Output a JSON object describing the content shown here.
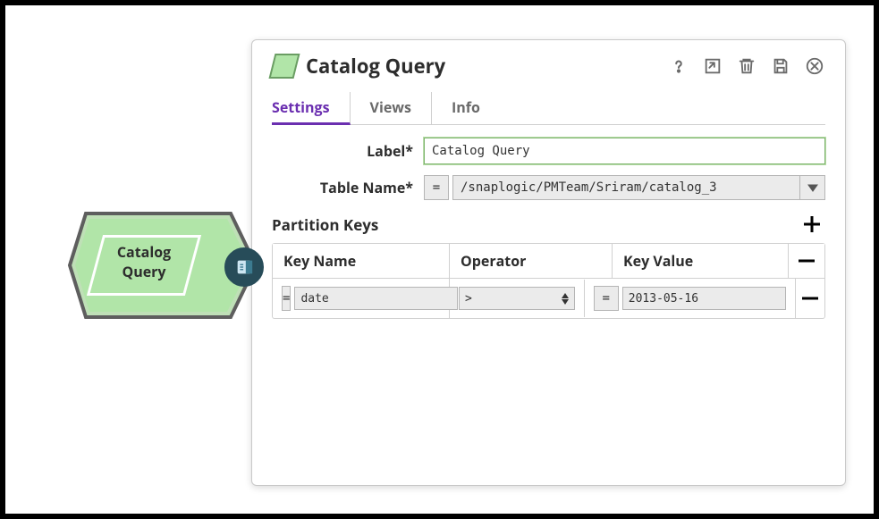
{
  "canvas": {
    "node_label": "Catalog Query"
  },
  "dialog": {
    "title": "Catalog Query",
    "tabs": [
      "Settings",
      "Views",
      "Info"
    ],
    "active_tab": 0,
    "fields": {
      "label_label": "Label*",
      "label_value": "Catalog Query",
      "table_name_label": "Table Name*",
      "table_name_value": "/snaplogic/PMTeam/Sriram/catalog_3",
      "eq_symbol": "="
    },
    "partition_keys": {
      "title": "Partition Keys",
      "columns": [
        "Key Name",
        "Operator",
        "Key Value"
      ],
      "rows": [
        {
          "key_name": "date",
          "operator": ">",
          "key_value": "2013-05-16"
        }
      ]
    }
  }
}
